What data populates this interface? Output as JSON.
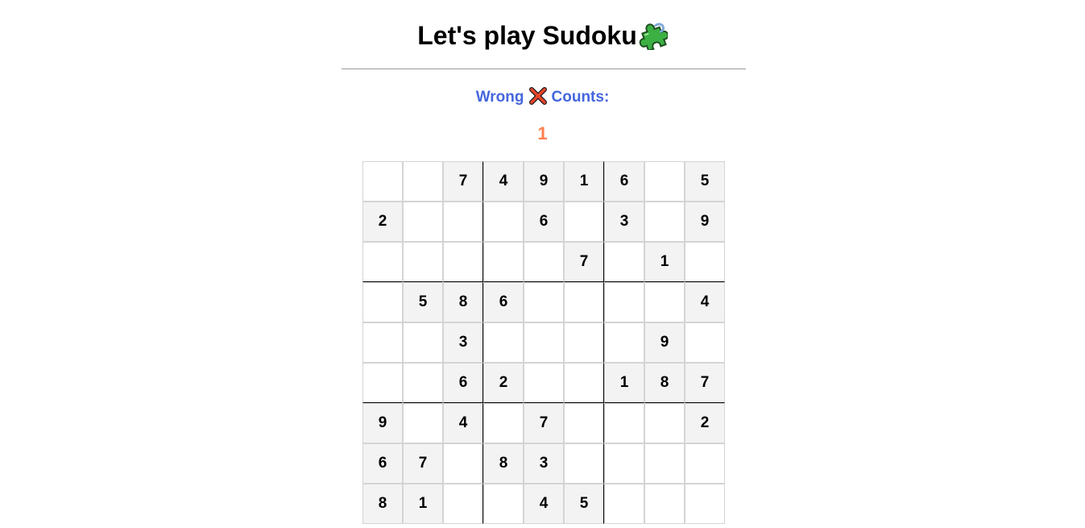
{
  "header": {
    "title": "Let's play Sudoku",
    "title_icon": "puzzle-piece-icon"
  },
  "status": {
    "wrong_label": "Wrong",
    "wrong_icon": "cross-mark-icon",
    "counts_label": "Counts:",
    "wrong_count": "1"
  },
  "colors": {
    "status_label": "#4466dd",
    "wrong_count": "#ff7f50",
    "given_cell_bg": "#f3f3f3",
    "cell_border": "#d4d4d4",
    "box_border": "#000000"
  },
  "board": {
    "rows": [
      [
        "",
        "",
        "7",
        "4",
        "9",
        "1",
        "6",
        "",
        "5"
      ],
      [
        "2",
        "",
        "",
        "",
        "6",
        "",
        "3",
        "",
        "9"
      ],
      [
        "",
        "",
        "",
        "",
        "",
        "7",
        "",
        "1",
        ""
      ],
      [
        "",
        "5",
        "8",
        "6",
        "",
        "",
        "",
        "",
        "4"
      ],
      [
        "",
        "",
        "3",
        "",
        "",
        "",
        "",
        "9",
        ""
      ],
      [
        "",
        "",
        "6",
        "2",
        "",
        "",
        "1",
        "8",
        "7"
      ],
      [
        "9",
        "",
        "4",
        "",
        "7",
        "",
        "",
        "",
        "2"
      ],
      [
        "6",
        "7",
        "",
        "8",
        "3",
        "",
        "",
        "",
        ""
      ],
      [
        "8",
        "1",
        "",
        "",
        "4",
        "5",
        "",
        "",
        ""
      ]
    ]
  }
}
